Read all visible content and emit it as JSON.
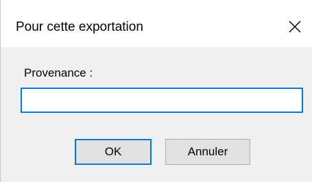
{
  "dialog": {
    "title": "Pour cette exportation",
    "close_icon": "close-icon",
    "field_label": "Provenance :",
    "field_value": "",
    "ok_label": "OK",
    "cancel_label": "Annuler"
  },
  "colors": {
    "accent": "#0078d7",
    "body_background": "#f0f0f0",
    "titlebar_background": "#ffffff",
    "button_background": "#e1e1e1"
  }
}
